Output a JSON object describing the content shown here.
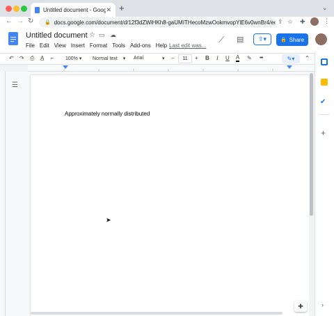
{
  "browser": {
    "tab_title": "Untitled document - Google D",
    "new_tab_icon": "plus-icon",
    "url": "docs.google.com/document/d/12f3dZWiHKh8-gaUMITHecoMzwOokmvopYlE6v0wnBr4/edit"
  },
  "doc": {
    "title": "Untitled document",
    "share_label": "Share",
    "last_edit": "Last edit was...",
    "menus": [
      "File",
      "Edit",
      "View",
      "Insert",
      "Format",
      "Tools",
      "Add-ons",
      "Help"
    ]
  },
  "toolbar": {
    "zoom": "100%",
    "style": "Normal text",
    "font": "Arial",
    "size": "11",
    "bold": "B",
    "italic": "I",
    "underline": "U",
    "text_color_glyph": "A",
    "more": "•••"
  },
  "content": {
    "text": "Approximately normally distributed"
  },
  "colors": {
    "accent": "#1a73e8",
    "docs_blue": "#4285f4"
  }
}
